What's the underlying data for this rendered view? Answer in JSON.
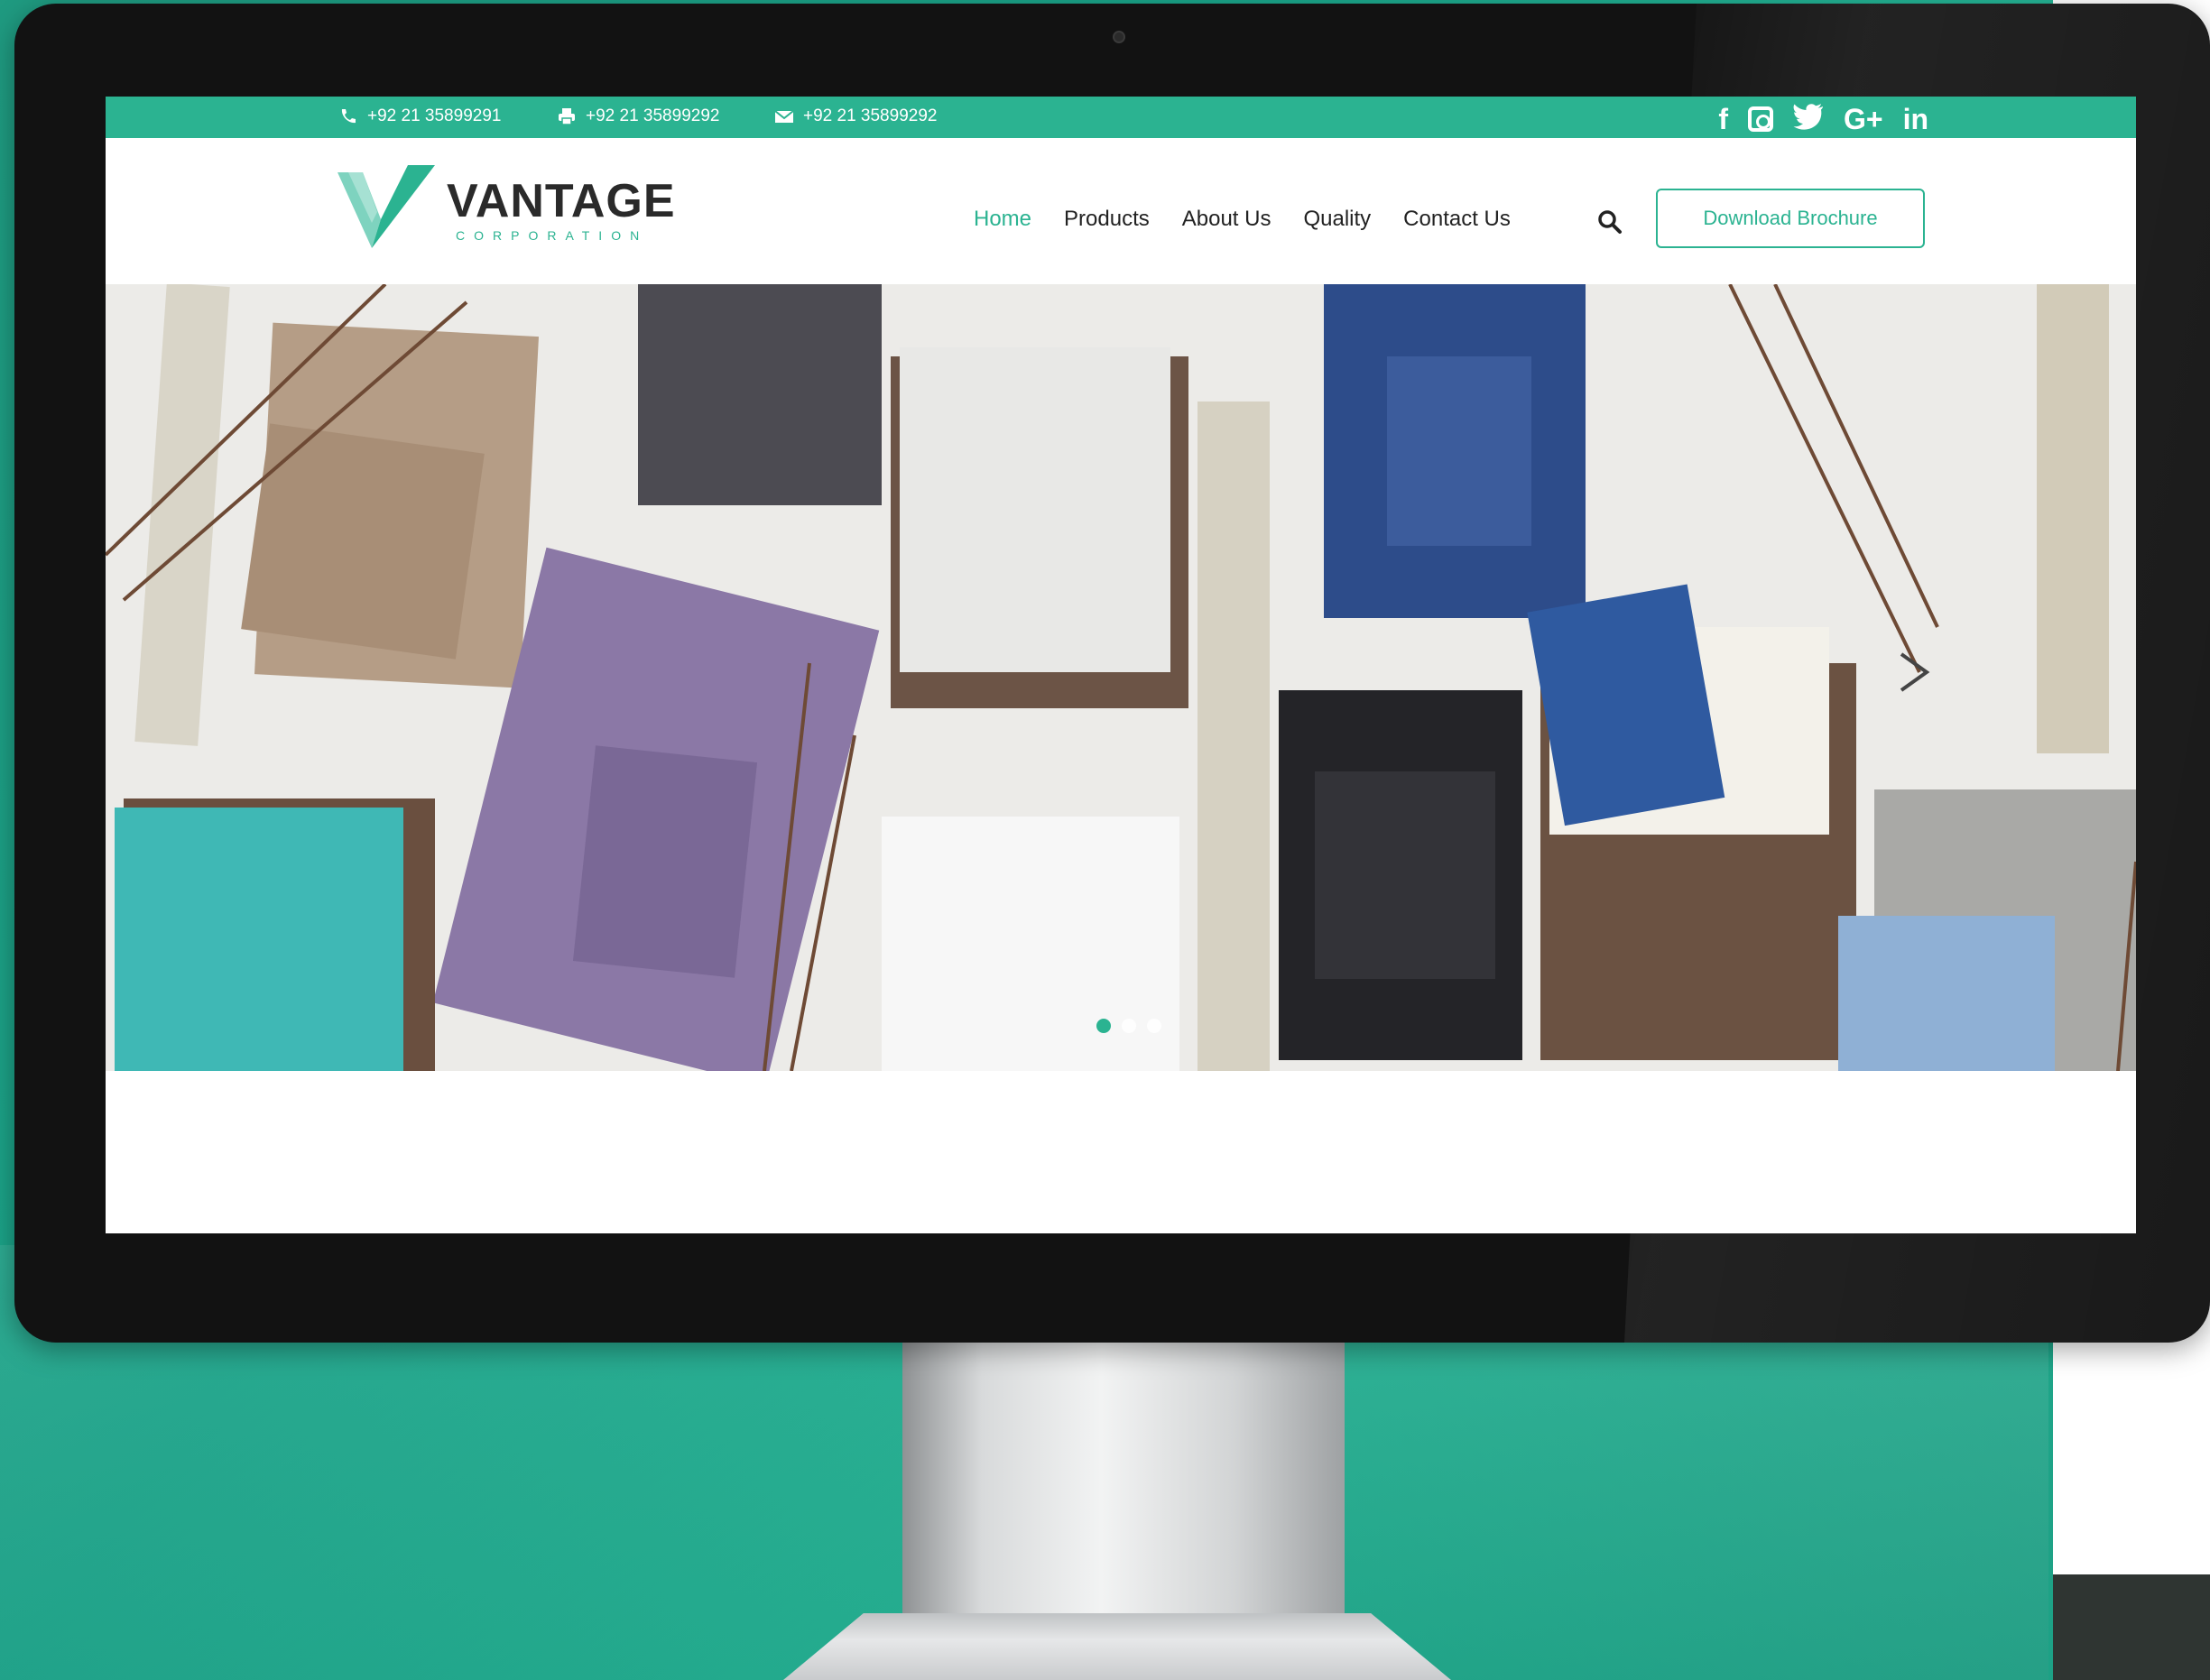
{
  "topbar": {
    "phone": "+92 21 35899291",
    "fax": "+92 21 35899292",
    "email": "+92 21 35899292",
    "socials": [
      "facebook-icon",
      "instagram-icon",
      "twitter-icon",
      "google-plus-icon",
      "linkedin-icon"
    ],
    "social_labels": {
      "facebook": "f",
      "twitter": "🐦",
      "gplus": "G+",
      "linkedin": "in"
    }
  },
  "brand": {
    "name": "VANTAGE",
    "tagline": "CORPORATION"
  },
  "nav": {
    "items": [
      {
        "label": "Home",
        "active": true
      },
      {
        "label": "Products",
        "active": false
      },
      {
        "label": "About Us",
        "active": false
      },
      {
        "label": "Quality",
        "active": false
      },
      {
        "label": "Contact Us",
        "active": false
      }
    ],
    "brochure_label": "Download Brochure"
  },
  "slider": {
    "total_slides": 3,
    "active_slide": 1
  },
  "colors": {
    "accent": "#2bb391",
    "text": "#222222",
    "bezel": "#121212"
  }
}
